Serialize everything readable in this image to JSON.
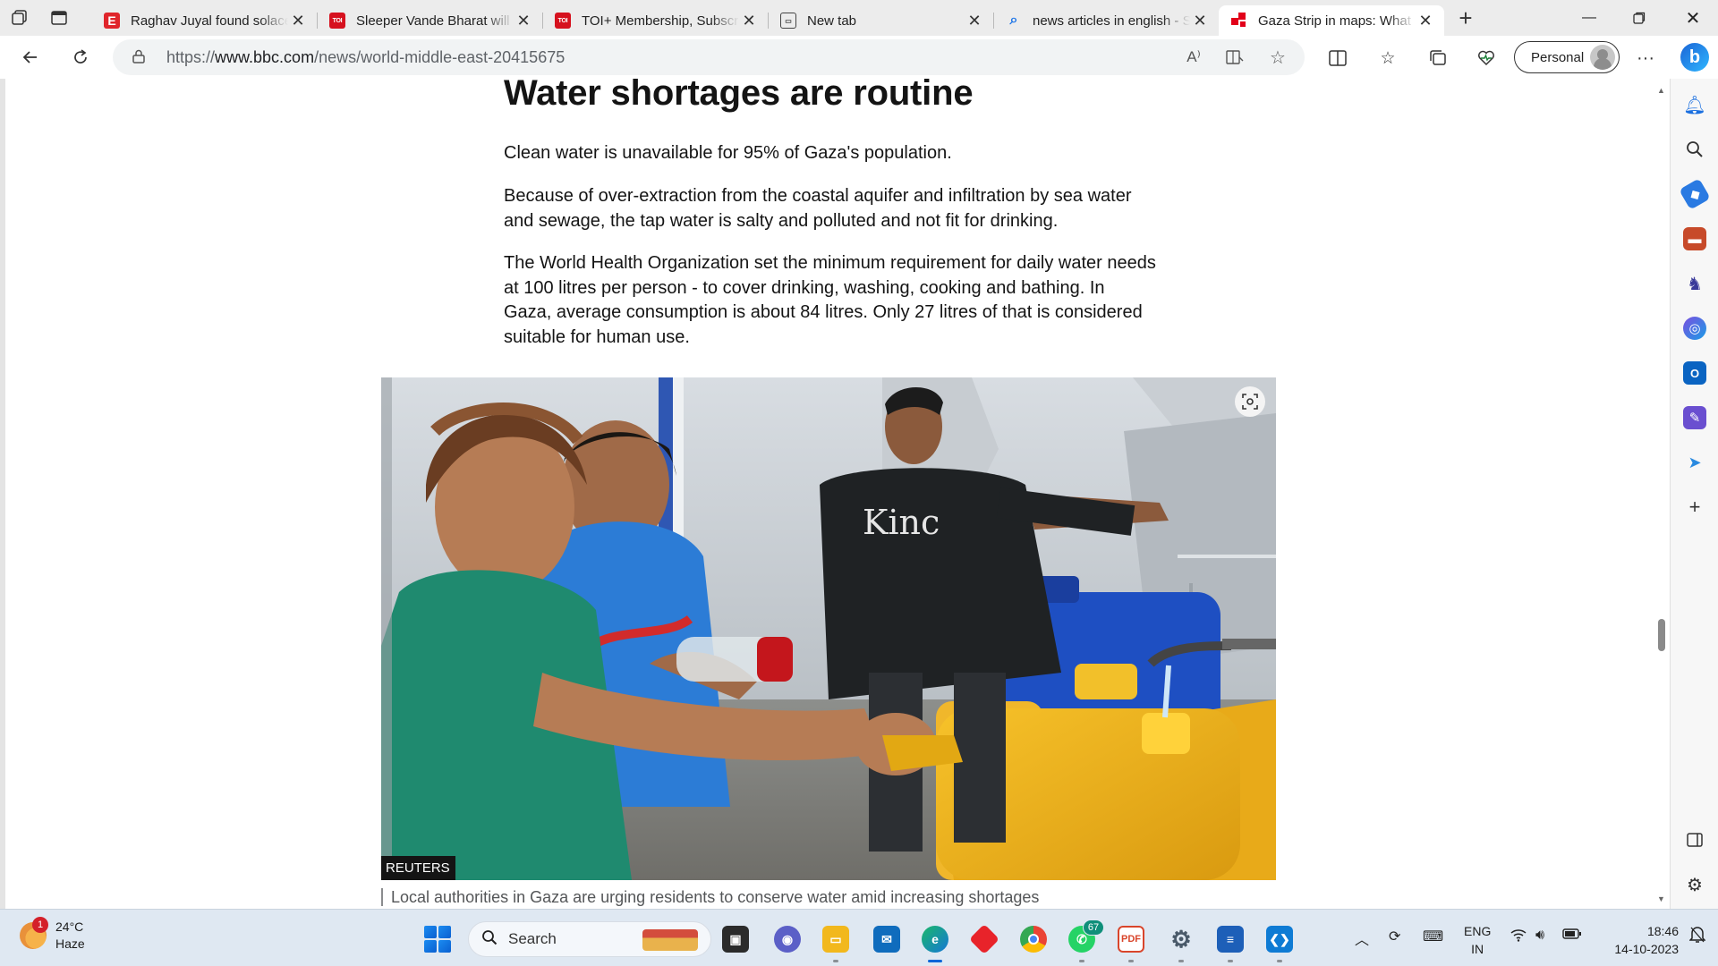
{
  "browser": {
    "tabs": [
      {
        "title": "Raghav Juyal found solace",
        "favicon": "E",
        "favicon_kind": "red"
      },
      {
        "title": "Sleeper Vande Bharat will c",
        "favicon": "TOI",
        "favicon_kind": "toi"
      },
      {
        "title": "TOI+ Membership, Subscri",
        "favicon": "TOI",
        "favicon_kind": "toi"
      },
      {
        "title": "New tab",
        "favicon": "new-tab-icon",
        "favicon_kind": "newtab"
      },
      {
        "title": "news articles in english - S",
        "favicon": "search-icon",
        "favicon_kind": "search"
      },
      {
        "title": "Gaza Strip in maps: What i",
        "favicon": "bbc-map-icon",
        "favicon_kind": "bbc",
        "active": true
      }
    ],
    "address": {
      "scheme": "https://",
      "host": "www.bbc.com",
      "path": "/news/world-middle-east-20415675"
    },
    "profile_label": "Personal",
    "bing_label": "b"
  },
  "article": {
    "heading": "Water shortages are routine",
    "paragraphs": [
      "Clean water is unavailable for 95% of Gaza's population.",
      "Because of over-extraction from the coastal aquifer and infiltration by sea water and sewage, the tap water is salty and polluted and not fit for drinking.",
      "The World Health Organization set the minimum requirement for daily water needs at 100 litres per person - to cover drinking, washing, cooking and bathing. In Gaza, average consumption is about 84 litres. Only 27 litres of that is considered suitable for human use."
    ],
    "image": {
      "credit": "REUTERS",
      "shirt_text": "Kinc"
    },
    "caption": "Local authorities in Gaza are urging residents to conserve water amid increasing shortages"
  },
  "taskbar": {
    "weather": {
      "temp": "24°C",
      "condition": "Haze",
      "badge": "1"
    },
    "search_placeholder": "Search",
    "whatsapp_badge": "67",
    "language": {
      "line1": "ENG",
      "line2": "IN"
    },
    "clock": {
      "time": "18:46",
      "date": "14-10-2023"
    }
  },
  "colors": {
    "accent": "#0b66d8",
    "bbc_red": "#e2001a",
    "text": "#141414"
  }
}
